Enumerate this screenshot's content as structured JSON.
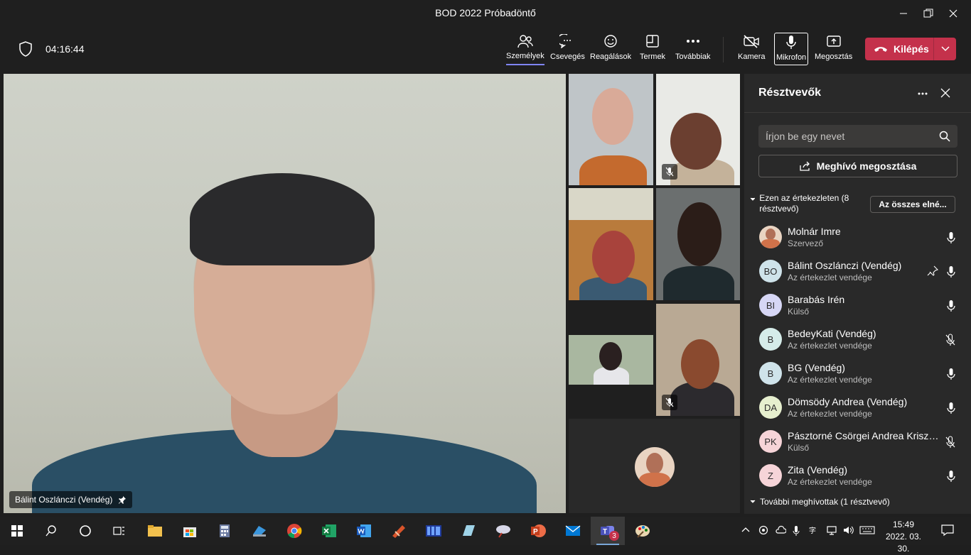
{
  "window": {
    "title": "BOD 2022 Próbadöntő"
  },
  "header": {
    "timer": "04:16:44",
    "buttons": {
      "people": "Személyek",
      "chat": "Csevegés",
      "reactions": "Reagálások",
      "rooms": "Termek",
      "more": "Továbbiak",
      "camera": "Kamera",
      "mic": "Mikrofon",
      "share": "Megosztás"
    },
    "leave": "Kilépés"
  },
  "stage": {
    "speaker_name": "Bálint Oszlánczi (Vendég)"
  },
  "panel": {
    "title": "Résztvevők",
    "search_placeholder": "Írjon be egy nevet",
    "invite_label": "Meghívó megosztása",
    "section_label": "Ezen az értekezleten (8 résztvevő)",
    "mute_all_label": "Az összes elné...",
    "participants": [
      {
        "name": "Molnár Imre",
        "role": "Szervező",
        "initials": "",
        "avatar_color": "#e9d4c2",
        "muted": false,
        "pinned": false
      },
      {
        "name": "Bálint Oszlánczi (Vendég)",
        "role": "Az értekezlet vendége",
        "initials": "BO",
        "avatar_color": "#cfe3ea",
        "muted": false,
        "pinned": true
      },
      {
        "name": "Barabás Irén",
        "role": "Külső",
        "initials": "BI",
        "avatar_color": "#d6d6f5",
        "muted": false,
        "pinned": false
      },
      {
        "name": "BedeyKati (Vendég)",
        "role": "Az értekezlet vendége",
        "initials": "B",
        "avatar_color": "#d5ece9",
        "muted": true,
        "pinned": false
      },
      {
        "name": "BG (Vendég)",
        "role": "Az értekezlet vendége",
        "initials": "B",
        "avatar_color": "#cfe3ea",
        "muted": false,
        "pinned": false
      },
      {
        "name": "Dömsödy Andrea (Vendég)",
        "role": "Az értekezlet vendége",
        "initials": "DA",
        "avatar_color": "#e6efce",
        "muted": false,
        "pinned": false
      },
      {
        "name": "Pásztorné Csörgei Andrea Krisztina",
        "role": "Külső",
        "initials": "PK",
        "avatar_color": "#f6d4d8",
        "muted": true,
        "pinned": false
      },
      {
        "name": "Zita (Vendég)",
        "role": "Az értekezlet vendége",
        "initials": "Z",
        "avatar_color": "#f6d4d8",
        "muted": false,
        "pinned": false
      }
    ],
    "more_invited": "További meghívottak (1 résztvevő)"
  },
  "taskbar": {
    "time": "15:49",
    "date": "2022. 03. 30.",
    "teams_badge": "3",
    "icons": [
      "start-icon",
      "search-icon",
      "cortana-icon",
      "task-view-icon",
      "file-explorer-icon",
      "store-icon",
      "calculator-icon",
      "app-icon",
      "chrome-icon",
      "excel-icon",
      "word-icon",
      "app-icon-2",
      "app-icon-3",
      "app-icon-4",
      "powerpoint-icon",
      "mail-icon",
      "teams-icon",
      "paint-icon"
    ]
  }
}
